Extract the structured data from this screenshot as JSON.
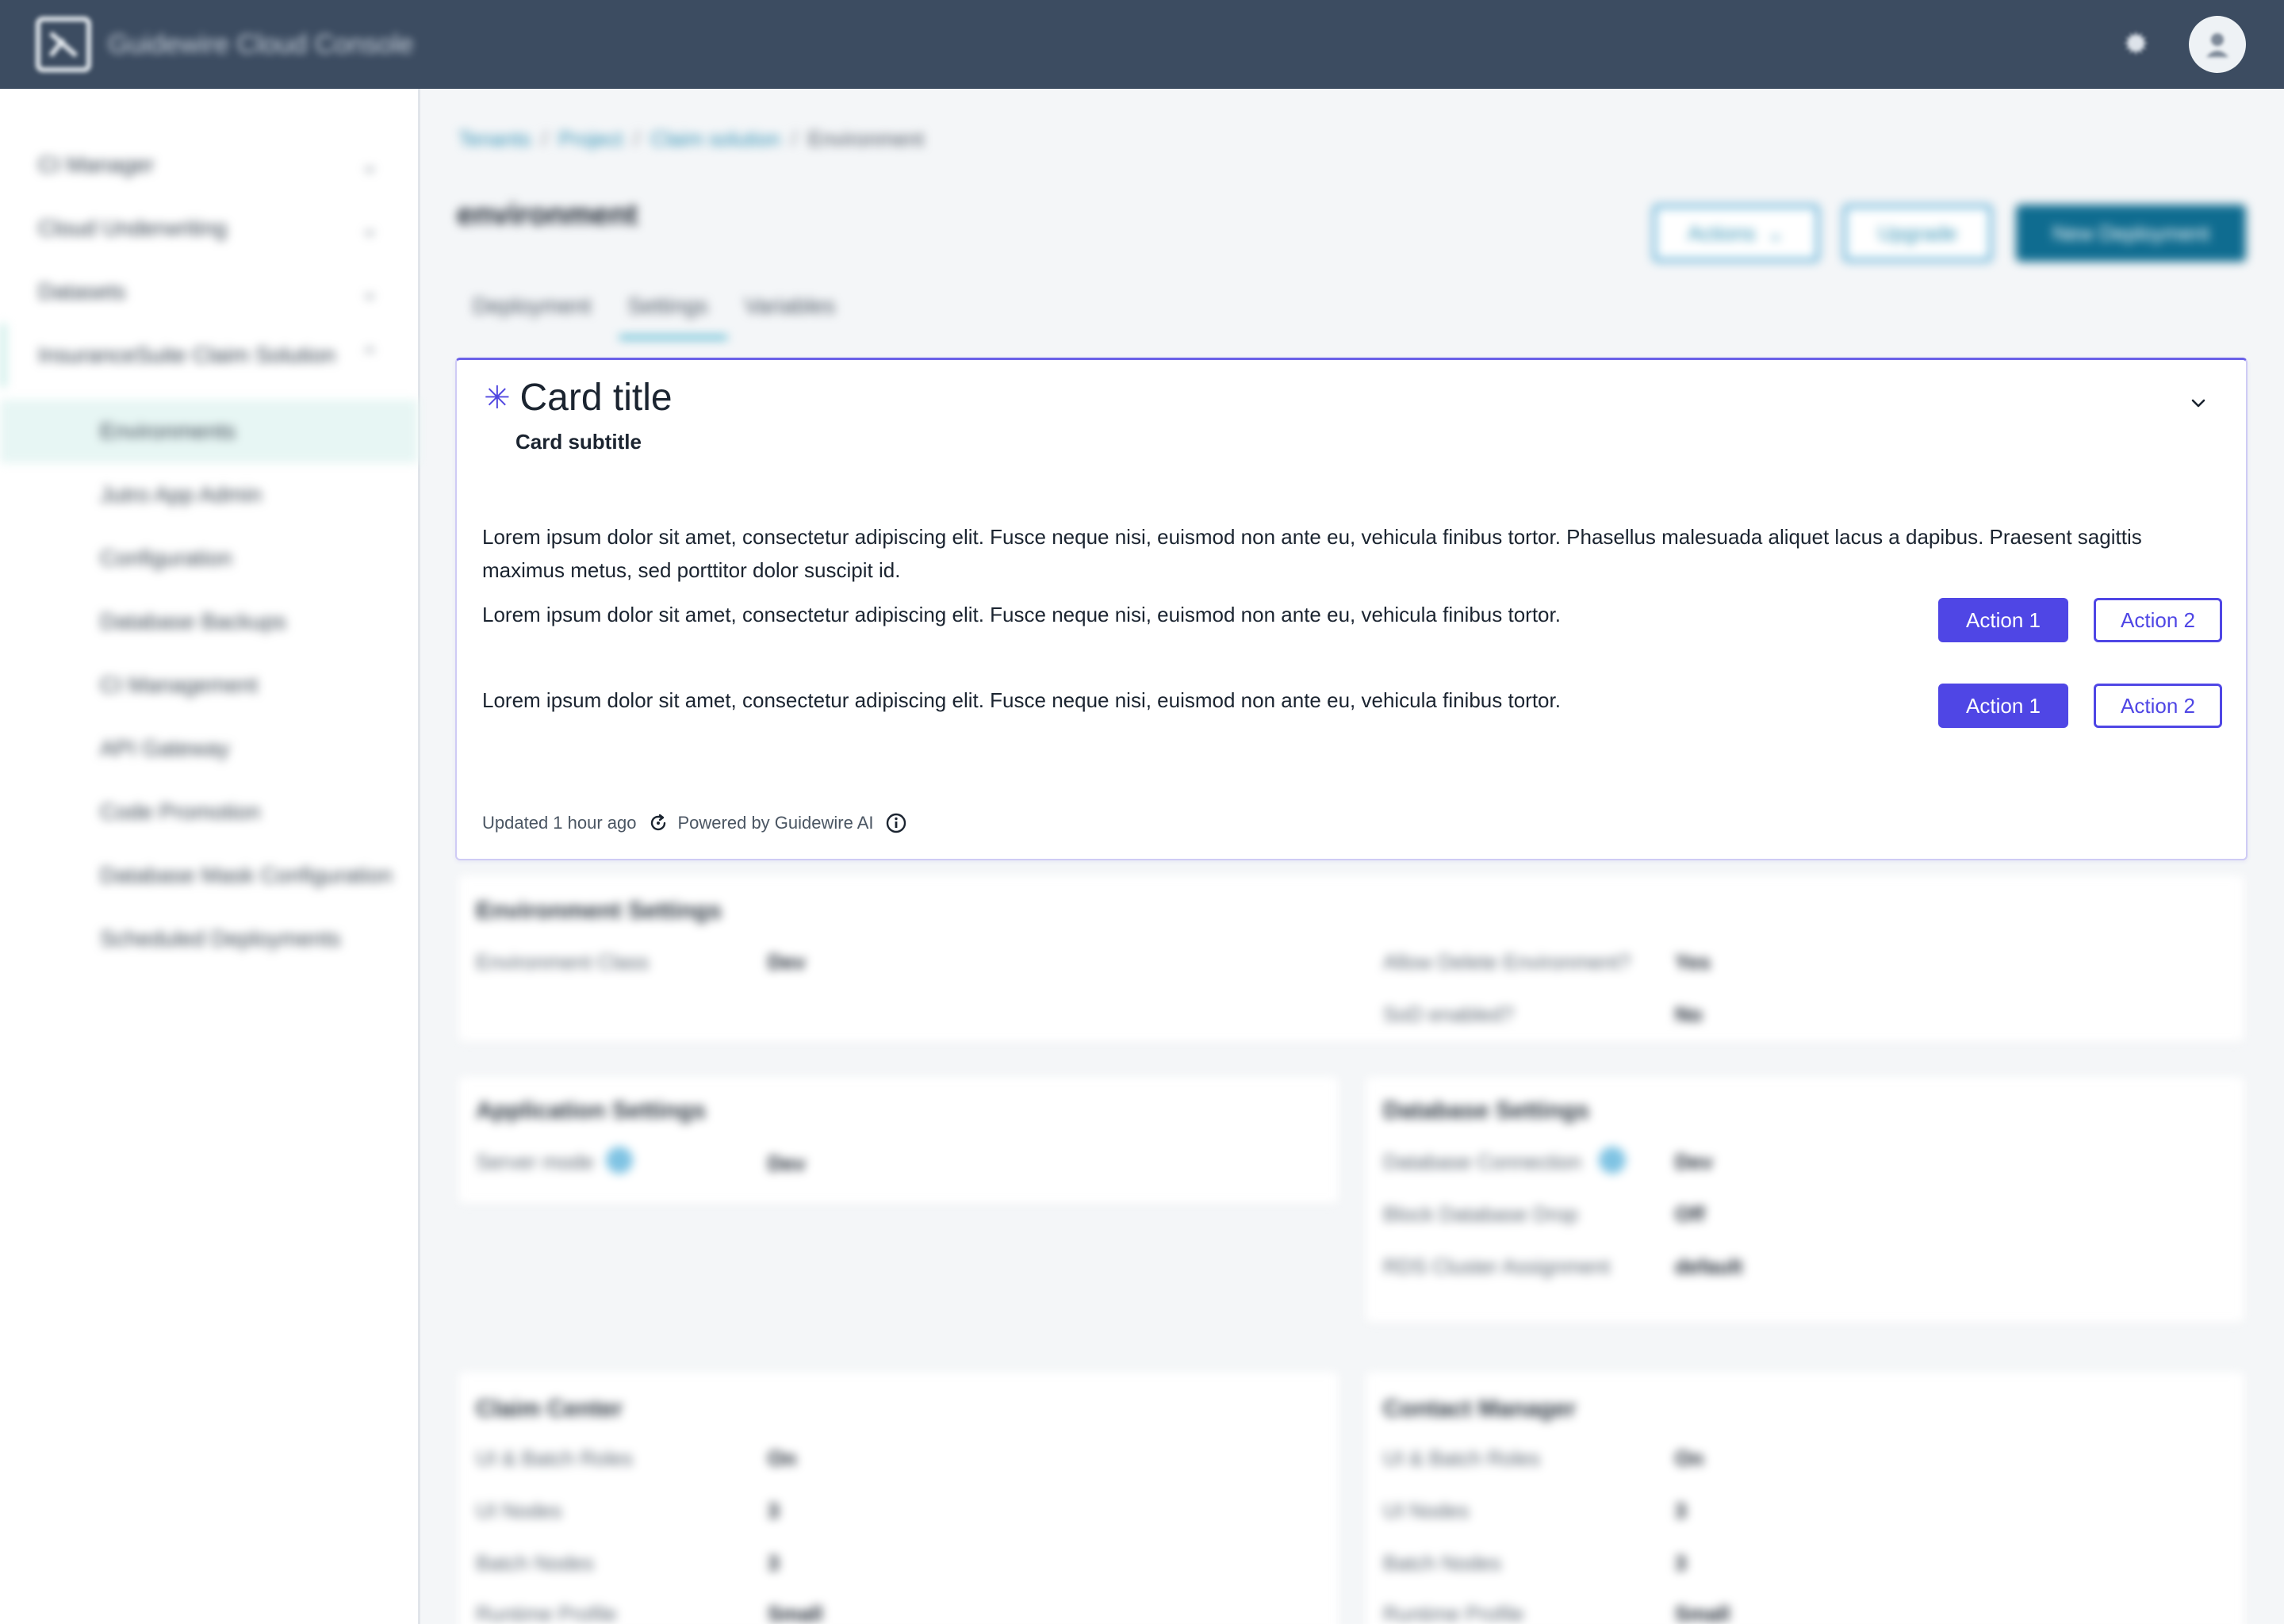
{
  "header": {
    "brand": "Guidewire Cloud Console",
    "colors": {
      "bar": "#3c4c61"
    }
  },
  "sidebar": {
    "items": [
      {
        "label": "CI Manager"
      },
      {
        "label": "Cloud Underwriting"
      },
      {
        "label": "Datasets"
      },
      {
        "label": "InsuranceSuite Claim Solution"
      }
    ],
    "subitems": [
      {
        "label": "Environments"
      },
      {
        "label": "Jutro App Admin"
      },
      {
        "label": "Configuration"
      },
      {
        "label": "Database Backups"
      },
      {
        "label": "CI Management"
      },
      {
        "label": "API Gateway"
      },
      {
        "label": "Code Promotion"
      },
      {
        "label": "Database Mask Configuration"
      },
      {
        "label": "Scheduled Deployments"
      }
    ]
  },
  "breadcrumb": {
    "items": [
      "Tenants",
      "Project",
      "Claim solution"
    ],
    "current": "Environment"
  },
  "page": {
    "title": "environment",
    "actions_label": "Actions",
    "upgrade_label": "Upgrade",
    "new_deployment_label": "New Deployment"
  },
  "tabs": [
    {
      "label": "Deployment"
    },
    {
      "label": "Settings"
    },
    {
      "label": "Variables"
    }
  ],
  "card": {
    "title": "Card title",
    "subtitle": "Card subtitle",
    "paragraph": "Lorem ipsum dolor sit amet, consectetur adipiscing elit. Fusce neque nisi, euismod non ante eu, vehicula finibus tortor. Phasellus malesuada aliquet lacus a dapibus. Praesent sagittis maximus metus, sed porttitor dolor suscipit id.",
    "rows": [
      {
        "text": "Lorem ipsum dolor sit amet, consectetur adipiscing elit. Fusce neque nisi, euismod non ante eu, vehicula finibus tortor.",
        "action1": "Action 1",
        "action2": "Action 2"
      },
      {
        "text": "Lorem ipsum dolor sit amet, consectetur adipiscing elit. Fusce neque nisi, euismod non ante eu, vehicula finibus tortor.",
        "action1": "Action 1",
        "action2": "Action 2"
      }
    ],
    "updated": "Updated 1 hour ago",
    "powered_by": "Powered by Guidewire AI",
    "colors": {
      "accent": "#4f46e5"
    }
  },
  "env_settings": {
    "title": "Environment Settings",
    "fields": [
      {
        "label": "Environment Class",
        "value": "Dev"
      },
      {
        "label": "Allow Delete Environment?",
        "value": "Yes"
      },
      {
        "label": "SoD enabled?",
        "value": "No"
      }
    ]
  },
  "app_settings": {
    "title": "Application Settings",
    "fields": [
      {
        "label": "Server mode",
        "value": "Dev"
      }
    ]
  },
  "db_settings": {
    "title": "Database Settings",
    "fields": [
      {
        "label": "Database Connection",
        "value": "Dev"
      },
      {
        "label": "Block Database Drop",
        "value": "Off"
      },
      {
        "label": "RDS Cluster Assignment",
        "value": "default"
      }
    ]
  },
  "claim_center": {
    "title": "Claim Center",
    "fields": [
      {
        "label": "UI & Batch Roles",
        "value": "On"
      },
      {
        "label": "UI Nodes",
        "value": "3"
      },
      {
        "label": "Batch Nodes",
        "value": "3"
      },
      {
        "label": "Runtime Profile",
        "value": "Small"
      }
    ]
  },
  "contact_manager": {
    "title": "Contact Manager",
    "fields": [
      {
        "label": "UI & Batch Roles",
        "value": "On"
      },
      {
        "label": "UI Nodes",
        "value": "3"
      },
      {
        "label": "Batch Nodes",
        "value": "3"
      },
      {
        "label": "Runtime Profile",
        "value": "Small"
      }
    ]
  }
}
